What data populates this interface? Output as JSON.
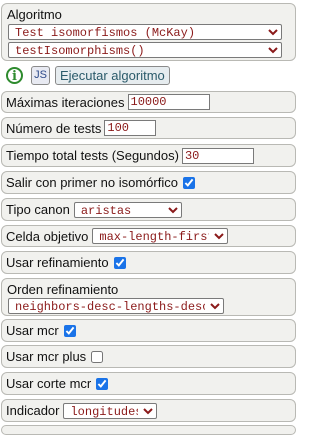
{
  "algorithm": {
    "title": "Algoritmo",
    "algorithm_select": "Test isomorfismos (McKay)",
    "function_select": "testIsomorphisms()",
    "js_label": "JS",
    "run_label": "Ejecutar algoritmo",
    "info_label": "i"
  },
  "params": {
    "max_iter_label": "Máximas iteraciones",
    "max_iter_value": "10000",
    "num_tests_label": "Número de tests",
    "num_tests_value": "100",
    "total_time_label": "Tiempo total tests (Segundos)",
    "total_time_value": "30",
    "exit_first_label": "Salir con primer no isomórfico",
    "exit_first_checked": true,
    "canon_type_label": "Tipo canon",
    "canon_type_value": "aristas",
    "target_cell_label": "Celda objetivo",
    "target_cell_value": "max-length-first",
    "use_refinement_label": "Usar refinamiento",
    "use_refinement_checked": true,
    "refinement_order_label": "Orden refinamiento",
    "refinement_order_value": "neighbors-desc-lengths-desc",
    "use_mcr_label": "Usar mcr",
    "use_mcr_checked": true,
    "use_mcr_plus_label": "Usar mcr plus",
    "use_mcr_plus_checked": false,
    "use_mcr_cut_label": "Usar corte mcr",
    "use_mcr_cut_checked": true,
    "indicator_label": "Indicador",
    "indicator_value": "longitudes"
  }
}
